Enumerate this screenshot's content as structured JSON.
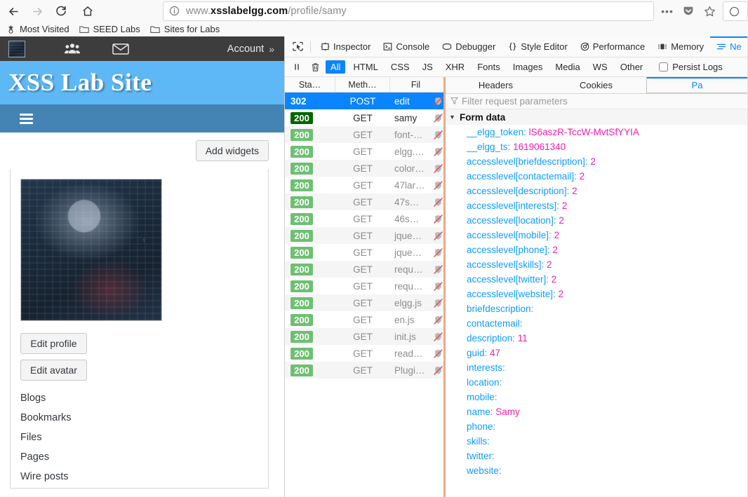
{
  "browser": {
    "nav": {
      "back_icon": "arrow-left-icon",
      "forward_icon": "arrow-right-icon",
      "reload_icon": "reload-icon",
      "home_icon": "home-icon"
    },
    "url": {
      "info_icon": "info-circle-icon",
      "prefix": "www.",
      "domain": "xsslabelgg.com",
      "path": "/profile/samy",
      "full": "www.xsslabelgg.com/profile/samy"
    },
    "right_controls": [
      {
        "name": "page-actions-button",
        "label": "•••"
      },
      {
        "name": "pocket-icon",
        "label": ""
      },
      {
        "name": "bookmark-star-icon",
        "label": ""
      }
    ],
    "bookmarks": [
      {
        "icon": "star-gear-icon",
        "label": "Most Visited"
      },
      {
        "icon": "folder-icon",
        "label": "SEED Labs"
      },
      {
        "icon": "folder-icon",
        "label": "Sites for Labs"
      }
    ]
  },
  "site": {
    "topbar": {
      "avatar_icon": "user-avatar-thumbnail",
      "friends_icon": "users-group-icon",
      "messages_icon": "envelope-icon",
      "account_label": "Account",
      "account_chevron": "»"
    },
    "title": "XSS Lab Site",
    "nav": {
      "menu_icon": "hamburger-menu-icon"
    },
    "add_widgets_label": "Add widgets",
    "profile": {
      "avatar_alt": "hacker-binary-avatar",
      "buttons": [
        {
          "name": "edit-profile-button",
          "label": "Edit profile"
        },
        {
          "name": "edit-avatar-button",
          "label": "Edit avatar"
        }
      ],
      "links": [
        {
          "name": "profile-link-blogs",
          "label": "Blogs"
        },
        {
          "name": "profile-link-bookmarks",
          "label": "Bookmarks"
        },
        {
          "name": "profile-link-files",
          "label": "Files"
        },
        {
          "name": "profile-link-pages",
          "label": "Pages"
        },
        {
          "name": "profile-link-wire-posts",
          "label": "Wire posts"
        }
      ]
    }
  },
  "devtools": {
    "picker_icon": "element-picker-icon",
    "tabs": [
      {
        "name": "tab-inspector",
        "icon": "inspector-icon",
        "label": "Inspector",
        "active": false
      },
      {
        "name": "tab-console",
        "icon": "console-icon",
        "label": "Console",
        "active": false
      },
      {
        "name": "tab-debugger",
        "icon": "debugger-icon",
        "label": "Debugger",
        "active": false
      },
      {
        "name": "tab-style-editor",
        "icon": "braces-icon",
        "label": "Style Editor",
        "active": false
      },
      {
        "name": "tab-performance",
        "icon": "performance-icon",
        "label": "Performance",
        "active": false
      },
      {
        "name": "tab-memory",
        "icon": "memory-icon",
        "label": "Memory",
        "active": false
      },
      {
        "name": "tab-network",
        "icon": "network-icon",
        "label": "Ne",
        "active": true
      }
    ],
    "filterbar": {
      "pause_icon": "pause-icon",
      "trash_icon": "trash-icon",
      "chips": [
        {
          "label": "All",
          "active": true
        },
        {
          "label": "HTML",
          "active": false
        },
        {
          "label": "CSS",
          "active": false
        },
        {
          "label": "JS",
          "active": false
        },
        {
          "label": "XHR",
          "active": false
        },
        {
          "label": "Fonts",
          "active": false
        },
        {
          "label": "Images",
          "active": false
        },
        {
          "label": "Media",
          "active": false
        },
        {
          "label": "WS",
          "active": false
        },
        {
          "label": "Other",
          "active": false
        }
      ],
      "persist_logs_label": "Persist Logs",
      "persist_logs_checked": false
    },
    "request_columns": [
      {
        "label": "Sta…"
      },
      {
        "label": "Meth…"
      },
      {
        "label": "Fil"
      }
    ],
    "requests": [
      {
        "status": "302",
        "method": "POST",
        "file": "edit",
        "style": "selected",
        "blocked_icon": "shield-slash-icon"
      },
      {
        "status": "200",
        "method": "GET",
        "file": "samy",
        "style": "darkgreen",
        "blocked_icon": "shield-slash-icon"
      },
      {
        "status": "200",
        "method": "GET",
        "file": "font-…",
        "style": "normal",
        "blocked_icon": "shield-slash-icon"
      },
      {
        "status": "200",
        "method": "GET",
        "file": "elgg.…",
        "style": "normal",
        "blocked_icon": "shield-slash-icon"
      },
      {
        "status": "200",
        "method": "GET",
        "file": "color…",
        "style": "normal",
        "blocked_icon": "shield-slash-icon"
      },
      {
        "status": "200",
        "method": "GET",
        "file": "47lar…",
        "style": "normal",
        "blocked_icon": "shield-slash-icon"
      },
      {
        "status": "200",
        "method": "GET",
        "file": "47s…",
        "style": "normal",
        "blocked_icon": "shield-slash-icon"
      },
      {
        "status": "200",
        "method": "GET",
        "file": "46s…",
        "style": "normal",
        "blocked_icon": "shield-slash-icon"
      },
      {
        "status": "200",
        "method": "GET",
        "file": "jque…",
        "style": "normal",
        "blocked_icon": "shield-slash-icon"
      },
      {
        "status": "200",
        "method": "GET",
        "file": "jque…",
        "style": "normal",
        "blocked_icon": "shield-slash-icon"
      },
      {
        "status": "200",
        "method": "GET",
        "file": "requ…",
        "style": "normal",
        "blocked_icon": "shield-slash-icon"
      },
      {
        "status": "200",
        "method": "GET",
        "file": "requ…",
        "style": "normal",
        "blocked_icon": "shield-slash-icon"
      },
      {
        "status": "200",
        "method": "GET",
        "file": "elgg.js",
        "style": "normal",
        "blocked_icon": "shield-slash-icon"
      },
      {
        "status": "200",
        "method": "GET",
        "file": "en.js",
        "style": "normal",
        "blocked_icon": "shield-slash-icon"
      },
      {
        "status": "200",
        "method": "GET",
        "file": "init.js",
        "style": "normal",
        "blocked_icon": "shield-slash-icon"
      },
      {
        "status": "200",
        "method": "GET",
        "file": "read…",
        "style": "normal",
        "blocked_icon": "shield-slash-icon"
      },
      {
        "status": "200",
        "method": "GET",
        "file": "Plugi…",
        "style": "normal",
        "blocked_icon": "shield-slash-icon"
      }
    ],
    "detail": {
      "tabs": [
        {
          "name": "detail-tab-headers",
          "label": "Headers",
          "active": false
        },
        {
          "name": "detail-tab-cookies",
          "label": "Cookies",
          "active": false
        },
        {
          "name": "detail-tab-params",
          "label": "Pa",
          "active": true
        }
      ],
      "param_filter_placeholder": "Filter request parameters",
      "param_filter_icon": "funnel-icon",
      "section_label": "Form data",
      "section_expanded": true,
      "form_data": [
        {
          "key": "__elgg_token",
          "value": "lS6aszR-TccW-MvtSfYYIA"
        },
        {
          "key": "__elgg_ts",
          "value": "1619061340"
        },
        {
          "key": "accesslevel[briefdescription]",
          "value": "2"
        },
        {
          "key": "accesslevel[contactemail]",
          "value": "2"
        },
        {
          "key": "accesslevel[description]",
          "value": "2"
        },
        {
          "key": "accesslevel[interests]",
          "value": "2"
        },
        {
          "key": "accesslevel[location]",
          "value": "2"
        },
        {
          "key": "accesslevel[mobile]",
          "value": "2"
        },
        {
          "key": "accesslevel[phone]",
          "value": "2"
        },
        {
          "key": "accesslevel[skills]",
          "value": "2"
        },
        {
          "key": "accesslevel[twitter]",
          "value": "2"
        },
        {
          "key": "accesslevel[website]",
          "value": "2"
        },
        {
          "key": "briefdescription",
          "value": ""
        },
        {
          "key": "contactemail",
          "value": ""
        },
        {
          "key": "description",
          "value": "11"
        },
        {
          "key": "guid",
          "value": "47"
        },
        {
          "key": "interests",
          "value": ""
        },
        {
          "key": "location",
          "value": ""
        },
        {
          "key": "mobile",
          "value": ""
        },
        {
          "key": "name",
          "value": "Samy"
        },
        {
          "key": "phone",
          "value": ""
        },
        {
          "key": "skills",
          "value": ""
        },
        {
          "key": "twitter",
          "value": ""
        },
        {
          "key": "website",
          "value": ""
        }
      ]
    }
  },
  "colors": {
    "accent_blue": "#0a84ff",
    "site_header_blue": "#5eb8f5",
    "site_nav_blue": "#4484b4",
    "topbar_dark": "#3d3d3d",
    "status_green": "#6fbf73",
    "status_green_dark": "#046504",
    "param_key": "#0f9bff",
    "param_value": "#ed1dad",
    "splitter": "#e8a988"
  }
}
